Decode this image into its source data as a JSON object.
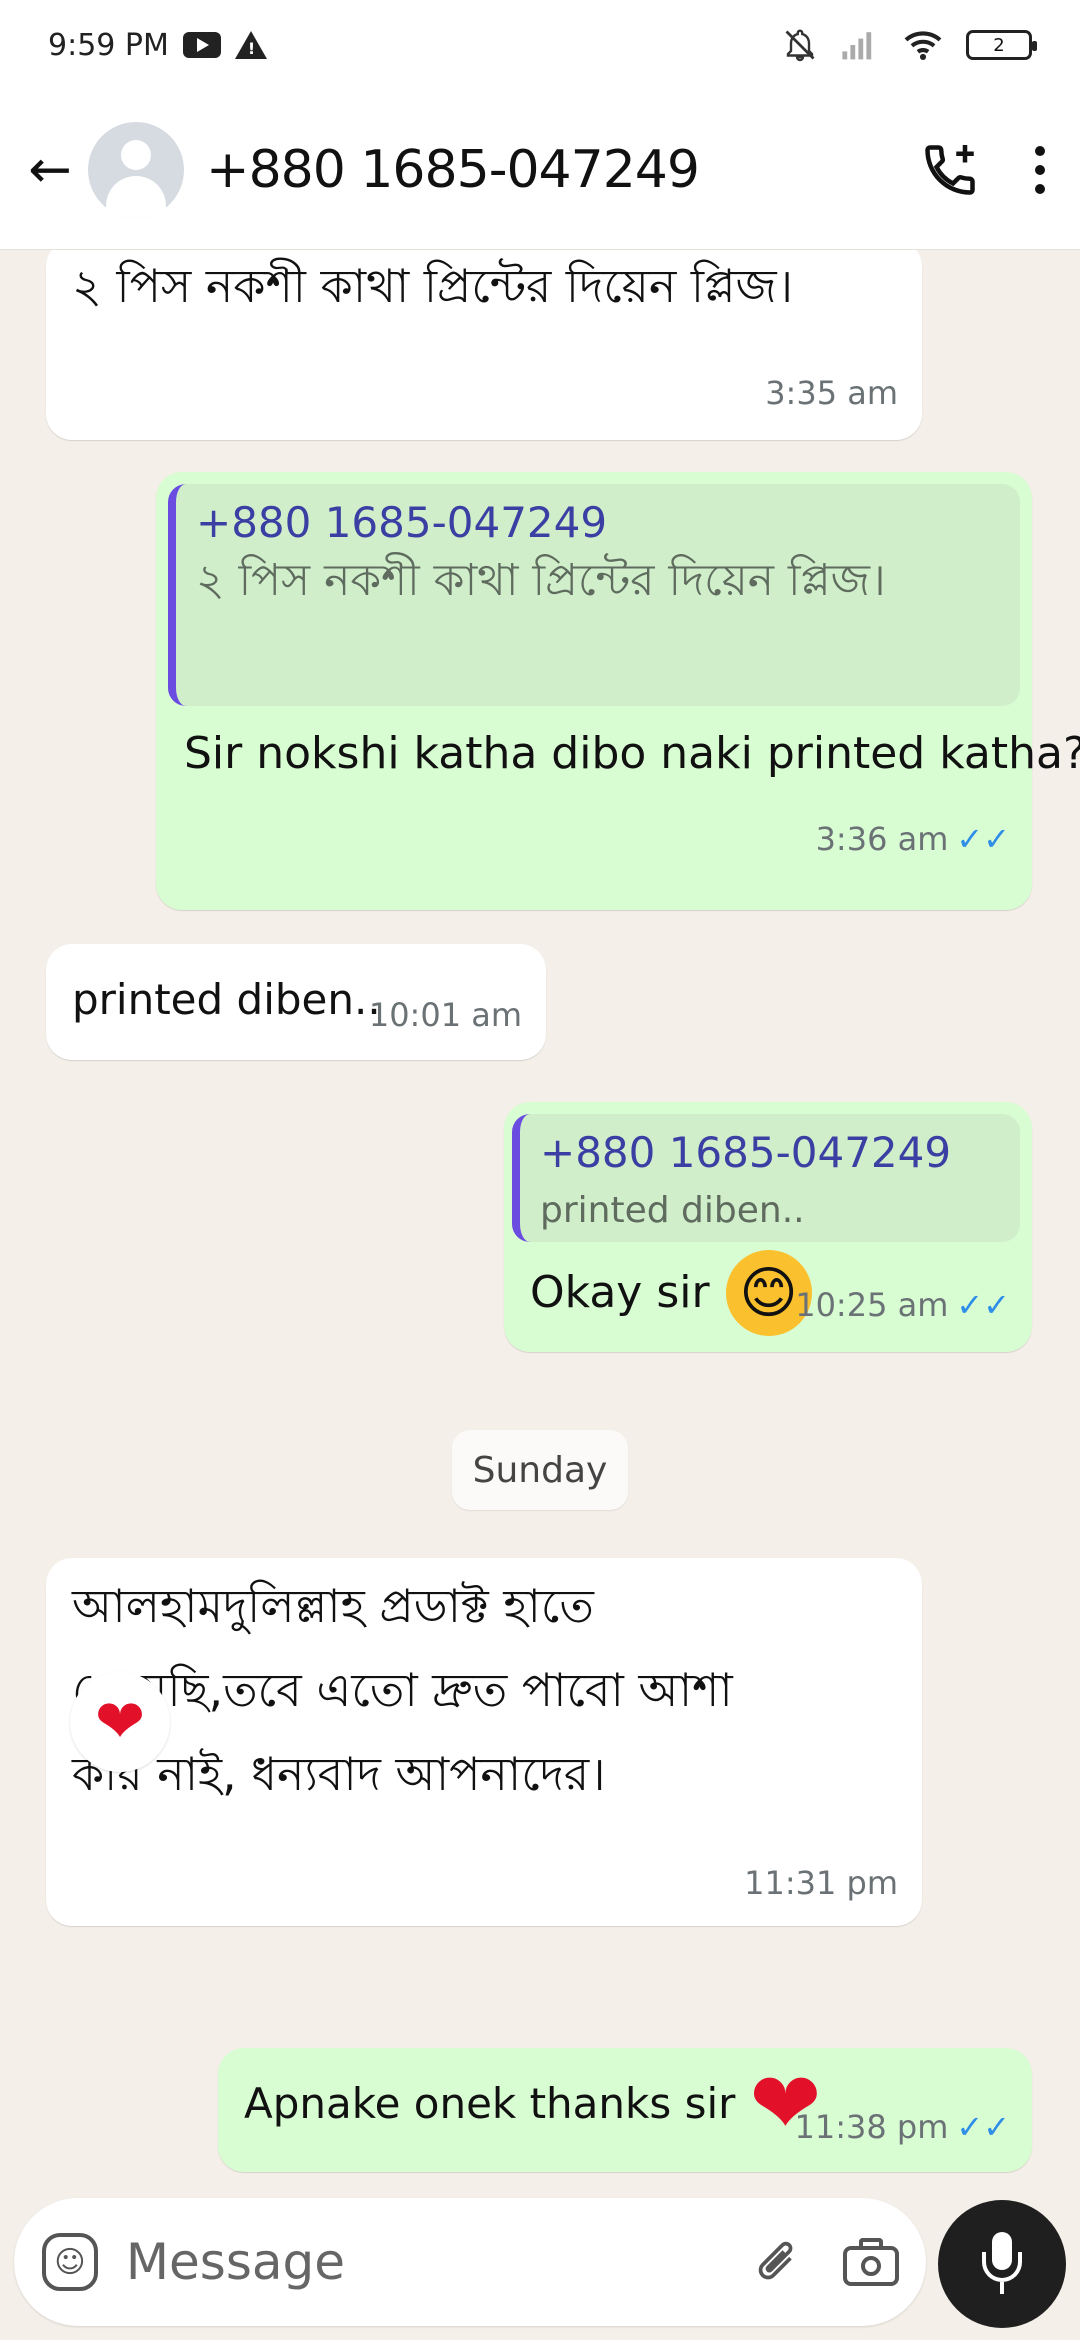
{
  "status_bar": {
    "time": "9:59 PM",
    "icons": [
      "youtube-icon",
      "warning-icon",
      "mute-icon",
      "signal-icon",
      "wifi-icon",
      "battery-icon"
    ],
    "battery_level": "2"
  },
  "header": {
    "contact_name": "+880 1685-047249",
    "icons": [
      "back-arrow-icon",
      "avatar",
      "add-call-icon",
      "more-menu-icon"
    ]
  },
  "messages": [
    {
      "dir": "in",
      "text": "২ পিস নকশী কাথা প্রিন্টের দিয়েন প্লিজ।",
      "time": "3:35 am"
    },
    {
      "dir": "out",
      "quote_name": "+880 1685-047249",
      "quote_text": "২ পিস নকশী কাথা প্রিন্টের দিয়েন প্লিজ।",
      "text": "Sir nokshi katha dibo naki printed katha?",
      "time": "3:36 am",
      "status": "read"
    },
    {
      "dir": "in",
      "text": "printed diben..",
      "time": "10:01 am"
    },
    {
      "dir": "out",
      "quote_name": "+880 1685-047249",
      "quote_text": "printed diben..",
      "text": "Okay sir",
      "emoji": "😊",
      "time": "10:25 am",
      "status": "read"
    },
    {
      "dir": "in",
      "text": "আলহামদুলিল্লাহ প্রডাক্ট হাতে পেয়েছি,তবে এতো দ্রুত পাবো আশা করি নাই, ধন্যবাদ আপনাদের।",
      "time": "11:31 pm",
      "reaction": "❤"
    },
    {
      "dir": "out",
      "text": "Apnake onek thanks sir",
      "emoji": "❤",
      "time": "11:38 pm",
      "status": "read"
    }
  ],
  "day_divider": "Sunday",
  "composer": {
    "placeholder": "Message",
    "icons": [
      "sticker-icon",
      "attach-icon",
      "camera-icon",
      "mic-icon"
    ]
  },
  "colors": {
    "outgoing_bubble": "#d9fdd3",
    "incoming_bubble": "#ffffff",
    "read_ticks": "#2f8ee8",
    "quote_bar": "#6a4de0",
    "chat_background": "#f4efe8"
  }
}
